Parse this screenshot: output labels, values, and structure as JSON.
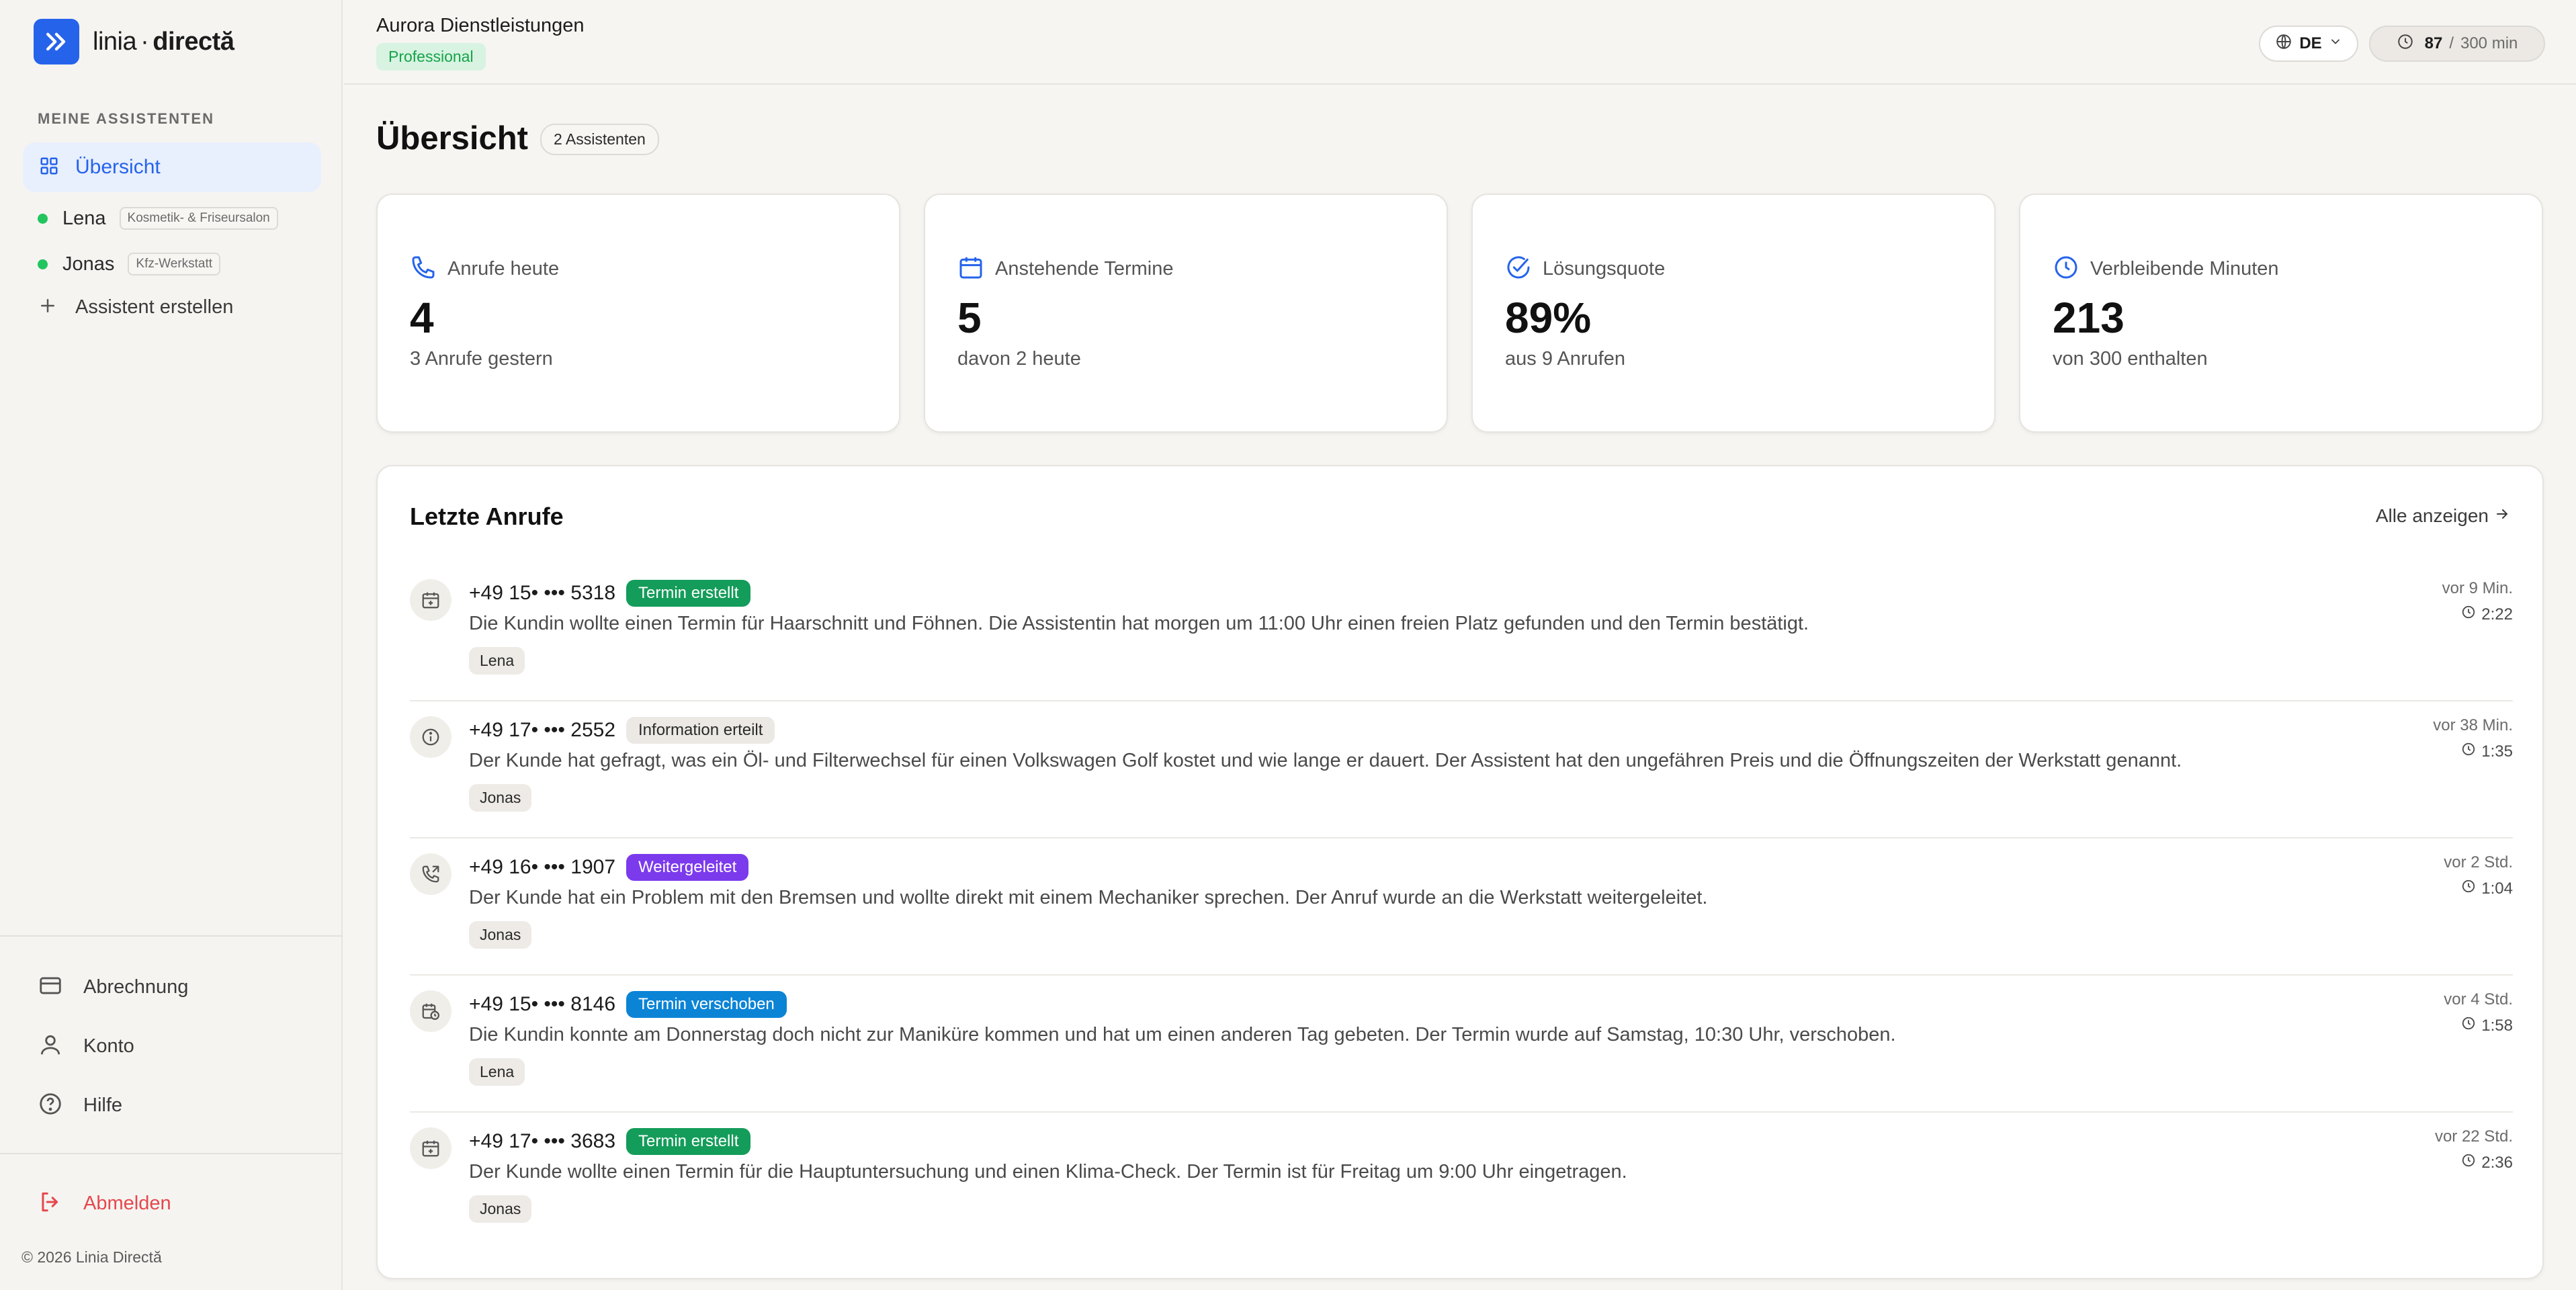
{
  "brand": {
    "name_a": "linia",
    "name_b": "directă",
    "separator": "·"
  },
  "sidebar": {
    "section_label": "MEINE ASSISTENTEN",
    "overview_label": "Übersicht",
    "assistants": [
      {
        "name": "Lena",
        "tag": "Kosmetik- & Friseursalon",
        "status_color": "#22c55e"
      },
      {
        "name": "Jonas",
        "tag": "Kfz-Werkstatt",
        "status_color": "#22c55e"
      }
    ],
    "create_label": "Assistent erstellen",
    "billing_label": "Abrechnung",
    "account_label": "Konto",
    "help_label": "Hilfe",
    "logout_label": "Abmelden",
    "copyright": "© 2026 Linia Directă"
  },
  "header": {
    "company": "Aurora Dienstleistungen",
    "plan": "Professional",
    "language": "DE",
    "minutes_used": "87",
    "minutes_sep": "/",
    "minutes_total": "300 min"
  },
  "main": {
    "title": "Übersicht",
    "assistant_count": "2 Assistenten",
    "stats": [
      {
        "label": "Anrufe heute",
        "value": "4",
        "sub": "3 Anrufe gestern",
        "icon": "phone-icon"
      },
      {
        "label": "Anstehende Termine",
        "value": "5",
        "sub": "davon 2 heute",
        "icon": "calendar-icon"
      },
      {
        "label": "Lösungsquote",
        "value": "89%",
        "sub": "aus 9 Anrufen",
        "icon": "check-circle-icon"
      },
      {
        "label": "Verbleibende Minuten",
        "value": "213",
        "sub": "von 300 enthalten",
        "icon": "clock-icon"
      }
    ],
    "recent_calls": {
      "title": "Letzte Anrufe",
      "show_all": "Alle anzeigen",
      "items": [
        {
          "number": "+49 15• ••• 5318",
          "status": "Termin erstellt",
          "description": "Die Kundin wollte einen Termin für Haarschnitt und Föhnen. Die Assistentin hat morgen um 11:00 Uhr einen freien Platz gefunden und den Termin bestätigt.",
          "assistant": "Lena",
          "time": "vor 9 Min.",
          "duration": "2:22",
          "icon": "calendar-plus-icon"
        },
        {
          "number": "+49 17• ••• 2552",
          "status": "Information erteilt",
          "description": "Der Kunde hat gefragt, was ein Öl- und Filterwechsel für einen Volkswagen Golf kostet und wie lange er dauert. Der Assistent hat den ungefähren Preis und die Öffnungszeiten der Werkstatt genannt.",
          "assistant": "Jonas",
          "time": "vor 38 Min.",
          "duration": "1:35",
          "icon": "info-icon"
        },
        {
          "number": "+49 16• ••• 1907",
          "status": "Weitergeleitet",
          "description": "Der Kunde hat ein Problem mit den Bremsen und wollte direkt mit einem Mechaniker sprechen. Der Anruf wurde an die Werkstatt weitergeleitet.",
          "assistant": "Jonas",
          "time": "vor 2 Std.",
          "duration": "1:04",
          "icon": "phone-forward-icon"
        },
        {
          "number": "+49 15• ••• 8146",
          "status": "Termin verschoben",
          "description": "Die Kundin konnte am Donnerstag doch nicht zur Maniküre kommen und hat um einen anderen Tag gebeten. Der Termin wurde auf Samstag, 10:30 Uhr, verschoben.",
          "assistant": "Lena",
          "time": "vor 4 Std.",
          "duration": "1:58",
          "icon": "calendar-clock-icon"
        },
        {
          "number": "+49 17• ••• 3683",
          "status": "Termin erstellt",
          "description": "Der Kunde wollte einen Termin für die Hauptuntersuchung und einen Klima-Check. Der Termin ist für Freitag um 9:00 Uhr eingetragen.",
          "assistant": "Jonas",
          "time": "vor 22 Std.",
          "duration": "2:36",
          "icon": "calendar-plus-icon"
        }
      ]
    }
  },
  "colors": {
    "accent": "#2563eb",
    "danger": "#e5484d",
    "status_green": "#149c5a",
    "status_purple": "#7c3aed",
    "status_blue": "#0b84d6"
  }
}
